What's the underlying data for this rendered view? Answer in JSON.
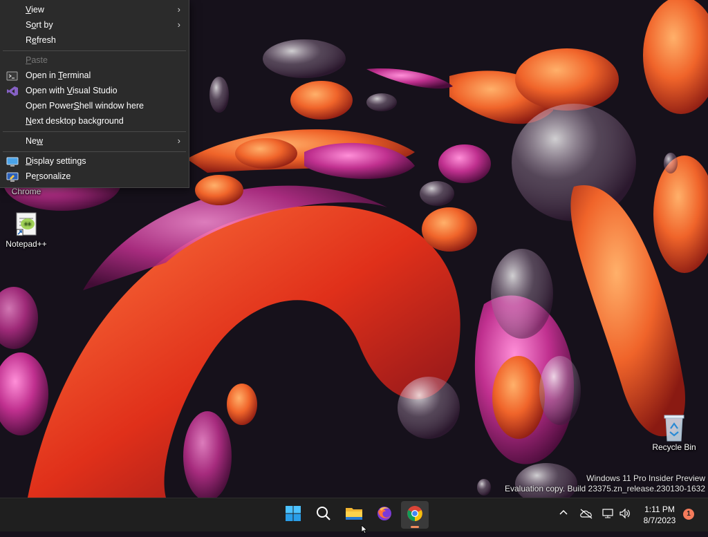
{
  "context_menu": {
    "items": [
      {
        "label_pre": "",
        "label_u": "V",
        "label_post": "iew",
        "submenu": true
      },
      {
        "label_pre": "S",
        "label_u": "o",
        "label_post": "rt by",
        "submenu": true
      },
      {
        "label_pre": "R",
        "label_u": "e",
        "label_post": "fresh",
        "submenu": false
      },
      {
        "label_pre": "",
        "label_u": "P",
        "label_post": "aste",
        "submenu": false,
        "disabled": true
      },
      {
        "label_pre": "Open in ",
        "label_u": "T",
        "label_post": "erminal",
        "icon": "terminal-icon"
      },
      {
        "label_pre": "Open with ",
        "label_u": "V",
        "label_post": "isual Studio",
        "icon": "visual-studio-icon"
      },
      {
        "label_pre": "Open Power",
        "label_u": "S",
        "label_post": "hell window here"
      },
      {
        "label_pre": "",
        "label_u": "N",
        "label_post": "ext desktop background"
      },
      {
        "label_pre": "Ne",
        "label_u": "w",
        "label_post": "",
        "submenu": true
      },
      {
        "label_pre": "",
        "label_u": "D",
        "label_post": "isplay settings",
        "icon": "display-settings-icon"
      },
      {
        "label_pre": "Pe",
        "label_u": "r",
        "label_post": "sonalize",
        "icon": "personalize-icon"
      }
    ],
    "submenu_arrow": "›"
  },
  "desktop_icons": {
    "chrome_label": "Chrome",
    "notepadpp_label": "Notepad++",
    "recycle_label": "Recycle Bin"
  },
  "watermark": {
    "line1": "Windows 11 Pro Insider Preview",
    "line2": "Evaluation copy. Build 23375.zn_release.230130-1632"
  },
  "taskbar": {
    "pinned": [
      "start-icon",
      "search-icon",
      "file-explorer-icon",
      "firefox-icon",
      "chrome-icon"
    ],
    "active": "chrome-icon",
    "time": "1:11 PM",
    "date": "8/7/2023",
    "notification_count": "1",
    "tray_chevron": "^"
  },
  "colors": {
    "menu_bg": "#2b2b2b",
    "taskbar_bg": "#1f1f1f",
    "accent": "#0078d4",
    "badge": "#f47b5b"
  }
}
